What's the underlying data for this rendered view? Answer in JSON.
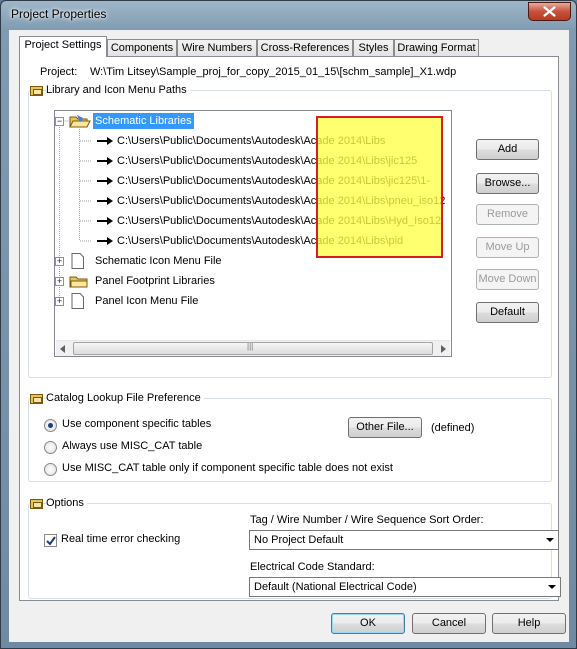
{
  "window": {
    "title": "Project Properties"
  },
  "tabs": [
    {
      "label": "Project Settings",
      "active": true
    },
    {
      "label": "Components"
    },
    {
      "label": "Wire Numbers"
    },
    {
      "label": "Cross-References"
    },
    {
      "label": "Styles"
    },
    {
      "label": "Drawing Format"
    }
  ],
  "project": {
    "label": "Project:",
    "path": "W:\\Tim Litsey\\Sample_proj_for_copy_2015_01_15\\[schm_sample]_X1.wdp"
  },
  "library_group": {
    "title": "Library and Icon Menu Paths",
    "tree": {
      "schematic_libraries": "Schematic Libraries",
      "paths": [
        "C:\\Users\\Public\\Documents\\Autodesk\\Acade 2014\\Libs",
        "C:\\Users\\Public\\Documents\\Autodesk\\Acade 2014\\Libs\\jic125",
        "C:\\Users\\Public\\Documents\\Autodesk\\Acade 2014\\Libs\\jic125\\1-",
        "C:\\Users\\Public\\Documents\\Autodesk\\Acade 2014\\Libs\\pneu_iso12",
        "C:\\Users\\Public\\Documents\\Autodesk\\Acade 2014\\Libs\\Hyd_Iso12",
        "C:\\Users\\Public\\Documents\\Autodesk\\Acade 2014\\Libs\\pid"
      ],
      "schematic_icon_menu": "Schematic Icon Menu File",
      "panel_footprint": "Panel Footprint Libraries",
      "panel_icon_menu": "Panel Icon Menu File",
      "scroll_thumb_glyph": "|||"
    },
    "buttons": {
      "add": "Add",
      "browse": "Browse...",
      "remove": "Remove",
      "move_up": "Move Up",
      "move_down": "Move Down",
      "default": "Default"
    }
  },
  "catalog_group": {
    "title": "Catalog Lookup File Preference",
    "options": [
      {
        "label": "Use component specific tables",
        "selected": true
      },
      {
        "label": "Always use MISC_CAT table",
        "selected": false
      },
      {
        "label": "Use MISC_CAT table only if component specific table does not exist",
        "selected": false
      }
    ],
    "other_file": "Other File...",
    "defined": "(defined)"
  },
  "options_group": {
    "title": "Options",
    "realtime_check": {
      "label": "Real time error checking",
      "checked": true
    },
    "sort_order_label": "Tag / Wire Number / Wire Sequence Sort Order:",
    "sort_order_value": "No Project Default",
    "standard_label": "Electrical Code Standard:",
    "standard_value": "Default (National Electrical Code)"
  },
  "footer": {
    "ok": "OK",
    "cancel": "Cancel",
    "help": "Help"
  },
  "colors": {
    "highlight": "#ffff46",
    "highlight_border": "#d42020",
    "selection": "#3399ff"
  }
}
